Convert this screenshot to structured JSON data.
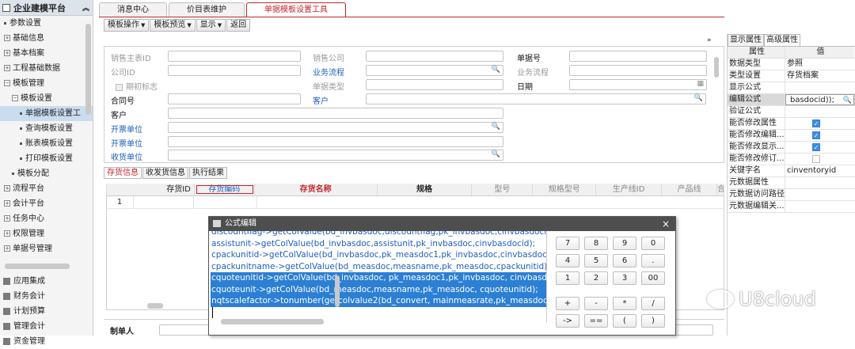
{
  "platform": {
    "title": "企业建模平台"
  },
  "nav": {
    "items": [
      {
        "label": "参数设置",
        "level": 1,
        "type": "dot"
      },
      {
        "label": "基础信息",
        "level": 1,
        "type": "plus"
      },
      {
        "label": "基本档案",
        "level": 1,
        "type": "plus"
      },
      {
        "label": "工程基础数据",
        "level": 1,
        "type": "plus"
      },
      {
        "label": "模板管理",
        "level": 1,
        "type": "minus"
      },
      {
        "label": "模板设置",
        "level": 2,
        "type": "minus"
      },
      {
        "label": "单据模板设置工",
        "level": 3,
        "type": "dot",
        "selected": true
      },
      {
        "label": "查询模板设置",
        "level": 3,
        "type": "dot"
      },
      {
        "label": "账表模板设置",
        "level": 3,
        "type": "dot"
      },
      {
        "label": "打印模板设置",
        "level": 3,
        "type": "dot"
      },
      {
        "label": "模板分配",
        "level": 2,
        "type": "dot"
      },
      {
        "label": "流程平台",
        "level": 1,
        "type": "plus"
      },
      {
        "label": "会计平台",
        "level": 1,
        "type": "plus"
      },
      {
        "label": "任务中心",
        "level": 1,
        "type": "plus"
      },
      {
        "label": "权限管理",
        "level": 1,
        "type": "plus"
      },
      {
        "label": "单据号管理",
        "level": 1,
        "type": "plus"
      }
    ],
    "bottom": [
      "应用集成",
      "财务会计",
      "计划预算",
      "管理会计",
      "资金管理"
    ]
  },
  "tabs": [
    {
      "label": "消息中心",
      "active": false
    },
    {
      "label": "价目表维护",
      "active": false
    },
    {
      "label": "单据模板设置工具",
      "active": true
    }
  ],
  "toolbar": {
    "template_ops": "模板操作",
    "template_preview": "模板预览",
    "display": "显示",
    "back": "返回"
  },
  "form": {
    "fields": {
      "sales_org_id": "销售主表ID",
      "sales_company": "销售公司",
      "doc_no": "单据号",
      "company_id": "公司ID",
      "biz_flow_blue": "业务流程",
      "biz_flow_gray": "业务流程",
      "opening_flag": "期初标志",
      "doc_type": "单据类型",
      "date": "日期",
      "contract_no": "合同号",
      "customer_blue": "客户",
      "customer": "客户",
      "invoice_unit_1": "开票单位",
      "invoice_unit_2": "开票单位",
      "receive_unit": "收货单位"
    }
  },
  "subtabs": [
    {
      "label": "存货信息",
      "active": true
    },
    {
      "label": "收发货信息",
      "active": false
    },
    {
      "label": "执行结果",
      "active": false
    }
  ],
  "grid": {
    "columns": [
      "存货ID",
      "存货编码",
      "存货名称",
      "规格",
      "型号",
      "规格型号",
      "生产线ID",
      "产品线",
      "合同"
    ],
    "row_no": "1"
  },
  "maker": {
    "label": "制单人"
  },
  "right_panel": {
    "tabs": [
      {
        "label": "显示属性",
        "active": false
      },
      {
        "label": "高级属性",
        "active": true
      }
    ],
    "head": {
      "key": "属性",
      "value": "值"
    },
    "rows": [
      {
        "key": "数据类型",
        "value": "参照"
      },
      {
        "key": "类型设置",
        "value": "存货档案"
      },
      {
        "key": "显示公式",
        "value": ""
      },
      {
        "key": "编辑公式",
        "value": "basdocid));"
      },
      {
        "key": "验证公式",
        "value": ""
      },
      {
        "key": "能否修改属性",
        "check": true
      },
      {
        "key": "能否修改编辑...",
        "check": true
      },
      {
        "key": "能否修改显示...",
        "check": true
      },
      {
        "key": "能否修改修订...",
        "check": false
      },
      {
        "key": "关键字名",
        "value": "cinventoryid"
      },
      {
        "key": "元数据属性",
        "value": ""
      },
      {
        "key": "元数据访问路径",
        "value": ""
      },
      {
        "key": "元数据编辑关...",
        "value": ""
      }
    ]
  },
  "dialog": {
    "title": "公式编辑",
    "close": "×",
    "code_lines": [
      {
        "text": "discountflag->getColValue(bd_invbasdoc,discountflag,pk_invbasdoc,cinvbasdocid",
        "hl": false
      },
      {
        "text": "assistunit->getColValue(bd_invbasdoc,assistunit,pk_invbasdoc,cinvbasdocid);",
        "hl": false
      },
      {
        "text": "cpackunitid->getColValue(bd_invbasdoc,pk_measdoc1,pk_invbasdoc,cinvbasdocid",
        "hl": false
      },
      {
        "text": "cpackunitname->getColValue(bd_measdoc,measname,pk_measdoc,cpackunitid);",
        "hl": false
      },
      {
        "text": "cquoteunitid->getColValue(bd_invbasdoc, pk_measdoc1,pk_invbasdoc, cinvbasdoc",
        "hl": true
      },
      {
        "text": "cquoteunit->getColValue(bd_measdoc,measname,pk_measdoc, cquoteunitid);",
        "hl": true
      },
      {
        "text": "nqtscalefactor->tonumber(getcolvalue2(bd_convert, mainmeasrate,pk_measdoc,cq",
        "hl": true
      }
    ],
    "keypad": [
      "7",
      "8",
      "9",
      "0",
      "4",
      "5",
      "6",
      ".",
      "1",
      "2",
      "3",
      "00",
      "+",
      "-",
      "*",
      "/",
      "->",
      "==",
      "(",
      ")"
    ]
  },
  "watermark": {
    "text": "U8cloud"
  }
}
